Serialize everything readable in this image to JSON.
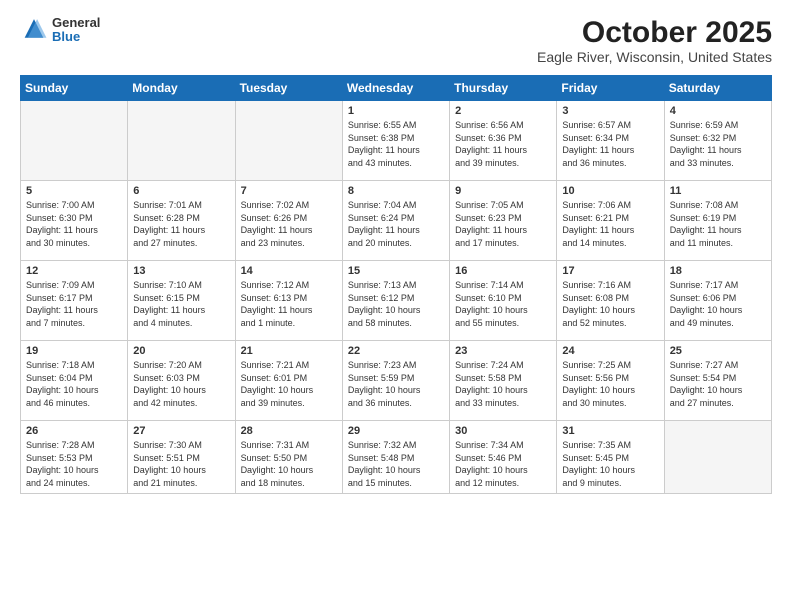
{
  "header": {
    "logo_general": "General",
    "logo_blue": "Blue",
    "month_title": "October 2025",
    "location": "Eagle River, Wisconsin, United States"
  },
  "weekdays": [
    "Sunday",
    "Monday",
    "Tuesday",
    "Wednesday",
    "Thursday",
    "Friday",
    "Saturday"
  ],
  "weeks": [
    [
      {
        "day": "",
        "info": ""
      },
      {
        "day": "",
        "info": ""
      },
      {
        "day": "",
        "info": ""
      },
      {
        "day": "1",
        "info": "Sunrise: 6:55 AM\nSunset: 6:38 PM\nDaylight: 11 hours\nand 43 minutes."
      },
      {
        "day": "2",
        "info": "Sunrise: 6:56 AM\nSunset: 6:36 PM\nDaylight: 11 hours\nand 39 minutes."
      },
      {
        "day": "3",
        "info": "Sunrise: 6:57 AM\nSunset: 6:34 PM\nDaylight: 11 hours\nand 36 minutes."
      },
      {
        "day": "4",
        "info": "Sunrise: 6:59 AM\nSunset: 6:32 PM\nDaylight: 11 hours\nand 33 minutes."
      }
    ],
    [
      {
        "day": "5",
        "info": "Sunrise: 7:00 AM\nSunset: 6:30 PM\nDaylight: 11 hours\nand 30 minutes."
      },
      {
        "day": "6",
        "info": "Sunrise: 7:01 AM\nSunset: 6:28 PM\nDaylight: 11 hours\nand 27 minutes."
      },
      {
        "day": "7",
        "info": "Sunrise: 7:02 AM\nSunset: 6:26 PM\nDaylight: 11 hours\nand 23 minutes."
      },
      {
        "day": "8",
        "info": "Sunrise: 7:04 AM\nSunset: 6:24 PM\nDaylight: 11 hours\nand 20 minutes."
      },
      {
        "day": "9",
        "info": "Sunrise: 7:05 AM\nSunset: 6:23 PM\nDaylight: 11 hours\nand 17 minutes."
      },
      {
        "day": "10",
        "info": "Sunrise: 7:06 AM\nSunset: 6:21 PM\nDaylight: 11 hours\nand 14 minutes."
      },
      {
        "day": "11",
        "info": "Sunrise: 7:08 AM\nSunset: 6:19 PM\nDaylight: 11 hours\nand 11 minutes."
      }
    ],
    [
      {
        "day": "12",
        "info": "Sunrise: 7:09 AM\nSunset: 6:17 PM\nDaylight: 11 hours\nand 7 minutes."
      },
      {
        "day": "13",
        "info": "Sunrise: 7:10 AM\nSunset: 6:15 PM\nDaylight: 11 hours\nand 4 minutes."
      },
      {
        "day": "14",
        "info": "Sunrise: 7:12 AM\nSunset: 6:13 PM\nDaylight: 11 hours\nand 1 minute."
      },
      {
        "day": "15",
        "info": "Sunrise: 7:13 AM\nSunset: 6:12 PM\nDaylight: 10 hours\nand 58 minutes."
      },
      {
        "day": "16",
        "info": "Sunrise: 7:14 AM\nSunset: 6:10 PM\nDaylight: 10 hours\nand 55 minutes."
      },
      {
        "day": "17",
        "info": "Sunrise: 7:16 AM\nSunset: 6:08 PM\nDaylight: 10 hours\nand 52 minutes."
      },
      {
        "day": "18",
        "info": "Sunrise: 7:17 AM\nSunset: 6:06 PM\nDaylight: 10 hours\nand 49 minutes."
      }
    ],
    [
      {
        "day": "19",
        "info": "Sunrise: 7:18 AM\nSunset: 6:04 PM\nDaylight: 10 hours\nand 46 minutes."
      },
      {
        "day": "20",
        "info": "Sunrise: 7:20 AM\nSunset: 6:03 PM\nDaylight: 10 hours\nand 42 minutes."
      },
      {
        "day": "21",
        "info": "Sunrise: 7:21 AM\nSunset: 6:01 PM\nDaylight: 10 hours\nand 39 minutes."
      },
      {
        "day": "22",
        "info": "Sunrise: 7:23 AM\nSunset: 5:59 PM\nDaylight: 10 hours\nand 36 minutes."
      },
      {
        "day": "23",
        "info": "Sunrise: 7:24 AM\nSunset: 5:58 PM\nDaylight: 10 hours\nand 33 minutes."
      },
      {
        "day": "24",
        "info": "Sunrise: 7:25 AM\nSunset: 5:56 PM\nDaylight: 10 hours\nand 30 minutes."
      },
      {
        "day": "25",
        "info": "Sunrise: 7:27 AM\nSunset: 5:54 PM\nDaylight: 10 hours\nand 27 minutes."
      }
    ],
    [
      {
        "day": "26",
        "info": "Sunrise: 7:28 AM\nSunset: 5:53 PM\nDaylight: 10 hours\nand 24 minutes."
      },
      {
        "day": "27",
        "info": "Sunrise: 7:30 AM\nSunset: 5:51 PM\nDaylight: 10 hours\nand 21 minutes."
      },
      {
        "day": "28",
        "info": "Sunrise: 7:31 AM\nSunset: 5:50 PM\nDaylight: 10 hours\nand 18 minutes."
      },
      {
        "day": "29",
        "info": "Sunrise: 7:32 AM\nSunset: 5:48 PM\nDaylight: 10 hours\nand 15 minutes."
      },
      {
        "day": "30",
        "info": "Sunrise: 7:34 AM\nSunset: 5:46 PM\nDaylight: 10 hours\nand 12 minutes."
      },
      {
        "day": "31",
        "info": "Sunrise: 7:35 AM\nSunset: 5:45 PM\nDaylight: 10 hours\nand 9 minutes."
      },
      {
        "day": "",
        "info": ""
      }
    ]
  ]
}
